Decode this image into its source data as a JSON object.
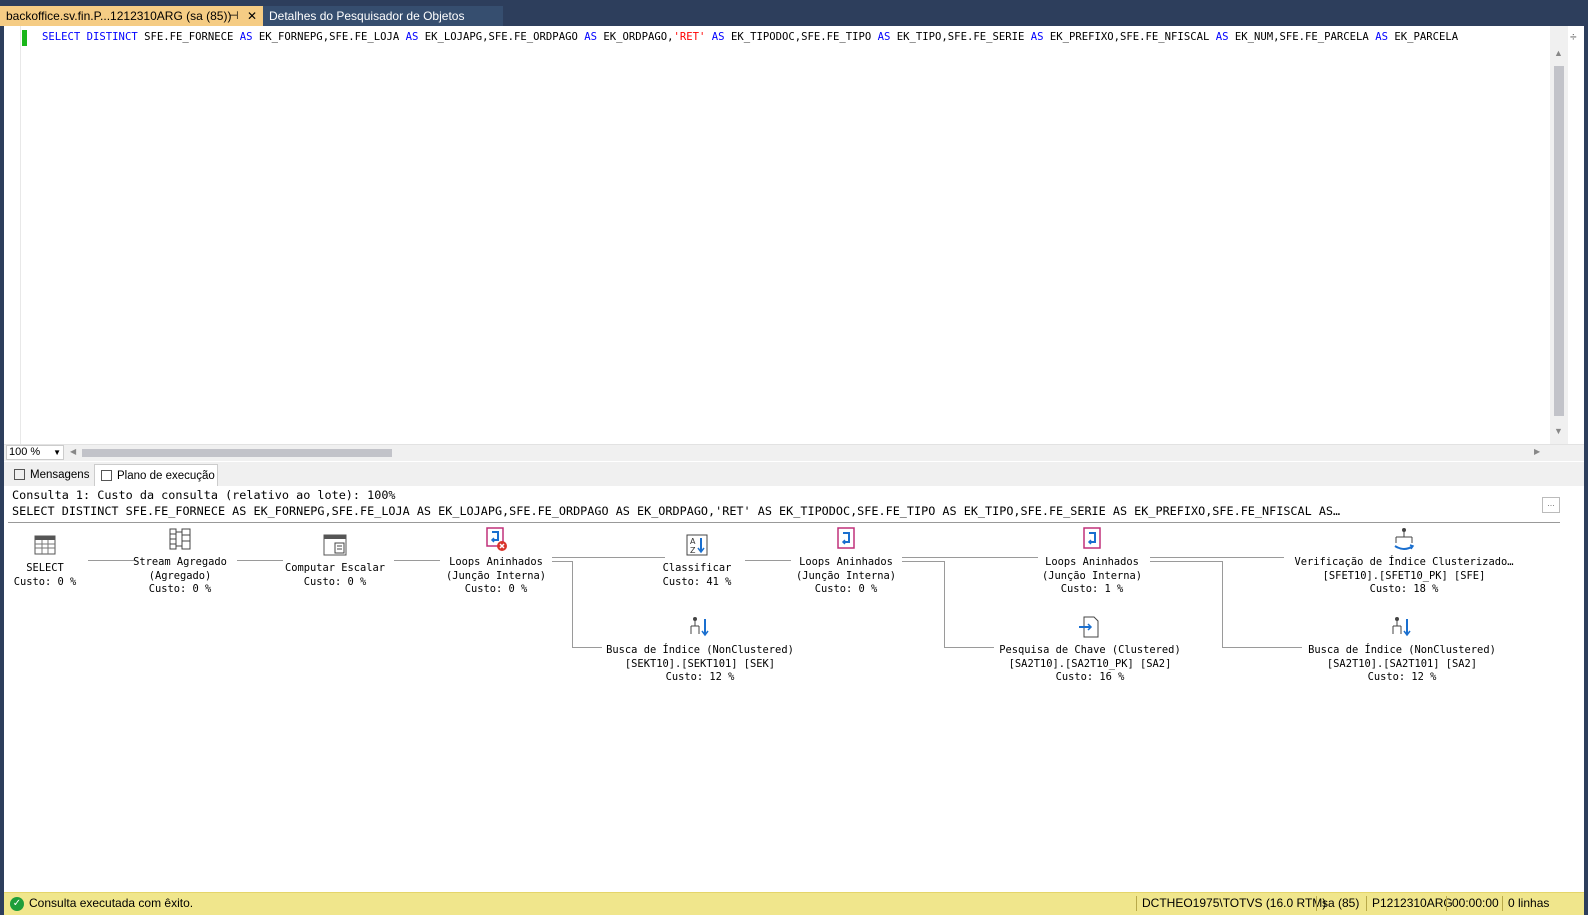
{
  "tabs": {
    "active": {
      "label": "backoffice.sv.fin.P...1212310ARG (sa (85))",
      "pin": "⊣",
      "close": "✕"
    },
    "inactive": {
      "label": "Detalhes do Pesquisador de Objetos"
    }
  },
  "editor": {
    "sql_parts": [
      {
        "t": "SELECT",
        "k": "kw"
      },
      {
        "t": " ",
        "k": ""
      },
      {
        "t": "DISTINCT",
        "k": "kw"
      },
      {
        "t": " SFE.FE_FORNECE ",
        "k": ""
      },
      {
        "t": "AS",
        "k": "kw"
      },
      {
        "t": " EK_FORNEPG,SFE.FE_LOJA ",
        "k": ""
      },
      {
        "t": "AS",
        "k": "kw"
      },
      {
        "t": " EK_LOJAPG,SFE.FE_ORDPAGO ",
        "k": ""
      },
      {
        "t": "AS",
        "k": "kw"
      },
      {
        "t": " EK_ORDPAGO,",
        "k": ""
      },
      {
        "t": "'RET'",
        "k": "str"
      },
      {
        "t": " ",
        "k": ""
      },
      {
        "t": "AS",
        "k": "kw"
      },
      {
        "t": " EK_TIPODOC,SFE.FE_TIPO ",
        "k": ""
      },
      {
        "t": "AS",
        "k": "kw"
      },
      {
        "t": " EK_TIPO,SFE.FE_SERIE ",
        "k": ""
      },
      {
        "t": "AS",
        "k": "kw"
      },
      {
        "t": " EK_PREFIXO,SFE.FE_NFISCAL ",
        "k": ""
      },
      {
        "t": "AS",
        "k": "kw"
      },
      {
        "t": " EK_NUM,SFE.FE_PARCELA ",
        "k": ""
      },
      {
        "t": "AS",
        "k": "kw"
      },
      {
        "t": " EK_PARCELA",
        "k": ""
      }
    ],
    "zoom": "100 %"
  },
  "result_tabs": {
    "messages": "Mensagens",
    "plan": "Plano de execução"
  },
  "plan": {
    "query_header": "Consulta 1: Custo da consulta (relativo ao lote): 100%",
    "query_text": "SELECT DISTINCT SFE.FE_FORNECE AS EK_FORNEPG,SFE.FE_LOJA AS EK_LOJAPG,SFE.FE_ORDPAGO AS EK_ORDPAGO,'RET' AS EK_TIPODOC,SFE.FE_TIPO AS EK_TIPO,SFE.FE_SERIE AS EK_PREFIXO,SFE.FE_NFISCAL AS…",
    "ellipsis_button": "...",
    "nodes": {
      "select": {
        "l1": "SELECT",
        "l2": "Custo: 0 %"
      },
      "stream": {
        "l1": "Stream Agregado",
        "l2": "(Agregado)",
        "l3": "Custo: 0 %"
      },
      "compute": {
        "l1": "Computar Escalar",
        "l2": "Custo: 0 %"
      },
      "loops1": {
        "l1": "Loops Aninhados",
        "l2": "(Junção Interna)",
        "l3": "Custo: 0 %"
      },
      "sort": {
        "l1": "Classificar",
        "l2": "Custo: 41 %"
      },
      "loops2": {
        "l1": "Loops Aninhados",
        "l2": "(Junção Interna)",
        "l3": "Custo: 0 %"
      },
      "loops3": {
        "l1": "Loops Aninhados",
        "l2": "(Junção Interna)",
        "l3": "Custo: 1 %"
      },
      "clustered_scan": {
        "l1": "Verificação de Índice Clusterizado…",
        "l2": "[SFET10].[SFET10_PK] [SFE]",
        "l3": "Custo: 18 %"
      },
      "seek_sek": {
        "l1": "Busca de Índice (NonClustered)",
        "l2": "[SEKT10].[SEKT101] [SEK]",
        "l3": "Custo: 12 %"
      },
      "key_lookup": {
        "l1": "Pesquisa de Chave (Clustered)",
        "l2": "[SA2T10].[SA2T10_PK] [SA2]",
        "l3": "Custo: 16 %"
      },
      "seek_sa2": {
        "l1": "Busca de Índice (NonClustered)",
        "l2": "[SA2T10].[SA2T101] [SA2]",
        "l3": "Custo: 12 %"
      }
    }
  },
  "status": {
    "message": "Consulta executada com êxito.",
    "server": "DCTHEO1975\\TOTVS (16.0 RTM)",
    "user": "sa (85)",
    "db": "P1212310ARG",
    "time": "00:00:00",
    "rows": "0 linhas"
  }
}
